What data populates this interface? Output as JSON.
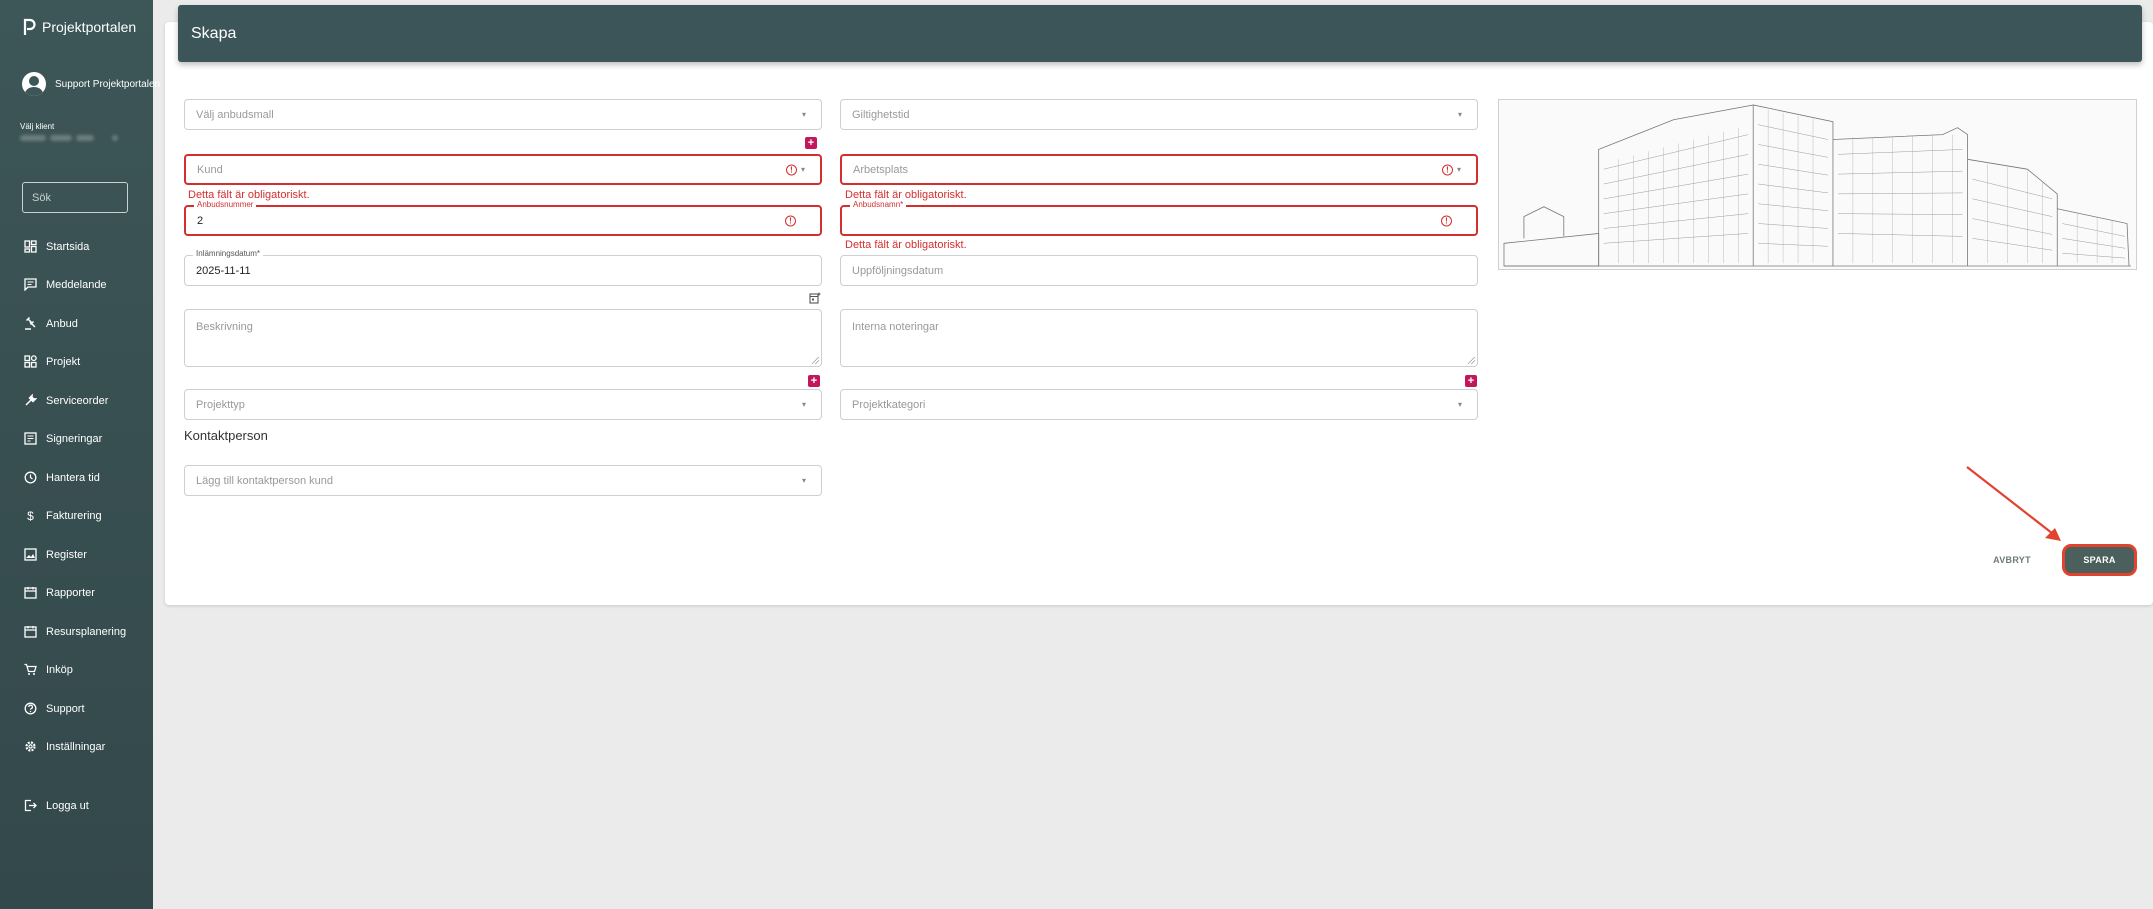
{
  "app": {
    "name": "Projektportalen"
  },
  "user": {
    "name": "Support Projektportalen"
  },
  "client": {
    "label": "Välj klient"
  },
  "search": {
    "placeholder": "Sök"
  },
  "nav": [
    {
      "label": "Startsida",
      "icon": "dashboard-icon"
    },
    {
      "label": "Meddelande",
      "icon": "message-icon"
    },
    {
      "label": "Anbud",
      "icon": "gavel-icon"
    },
    {
      "label": "Projekt",
      "icon": "project-icon"
    },
    {
      "label": "Serviceorder",
      "icon": "wrench-icon"
    },
    {
      "label": "Signeringar",
      "icon": "signature-icon"
    },
    {
      "label": "Hantera tid",
      "icon": "clock-icon"
    },
    {
      "label": "Fakturering",
      "icon": "dollar-icon"
    },
    {
      "label": "Register",
      "icon": "image-icon"
    },
    {
      "label": "Rapporter",
      "icon": "calendar-icon"
    },
    {
      "label": "Resursplanering",
      "icon": "calendar-icon"
    },
    {
      "label": "Inköp",
      "icon": "cart-icon"
    },
    {
      "label": "Support",
      "icon": "help-icon"
    },
    {
      "label": "Inställningar",
      "icon": "gear-icon"
    }
  ],
  "logout": {
    "label": "Logga ut"
  },
  "header": {
    "title": "Skapa"
  },
  "form": {
    "template": {
      "placeholder": "Välj anbudsmall"
    },
    "validity": {
      "placeholder": "Giltighetstid"
    },
    "customer": {
      "placeholder": "Kund",
      "error": "Detta fält är obligatoriskt."
    },
    "workplace": {
      "placeholder": "Arbetsplats",
      "error": "Detta fält är obligatoriskt."
    },
    "bid_number": {
      "label": "Anbudsnummer",
      "value": "2"
    },
    "bid_name": {
      "label": "Anbudsnamn*",
      "value": "",
      "error": "Detta fält är obligatoriskt."
    },
    "submission_date": {
      "label": "Inlämningsdatum*",
      "value": "2025-11-11"
    },
    "followup_date": {
      "placeholder": "Uppföljningsdatum"
    },
    "description": {
      "placeholder": "Beskrivning"
    },
    "internal_notes": {
      "placeholder": "Interna noteringar"
    },
    "project_type": {
      "placeholder": "Projekttyp"
    },
    "project_category": {
      "placeholder": "Projektkategori"
    },
    "contact_section": {
      "title": "Kontaktperson"
    },
    "contact_person": {
      "placeholder": "Lägg till kontaktperson kund"
    }
  },
  "actions": {
    "cancel": "AVBRYT",
    "save": "SPARA"
  },
  "colors": {
    "sidebar": "#3d5658",
    "header": "#3c5558",
    "error": "#d32f2f",
    "accent": "#c2185b",
    "save_button": "#4b5f5c",
    "highlight": "#e2432e"
  }
}
